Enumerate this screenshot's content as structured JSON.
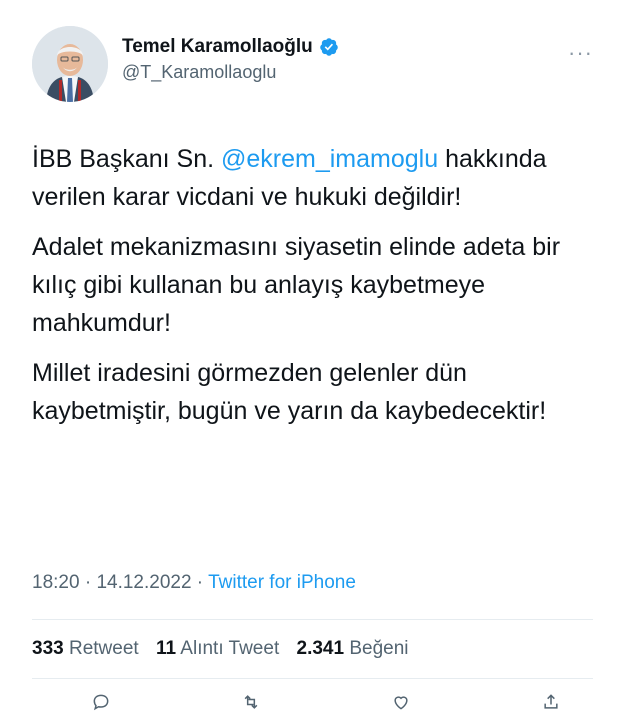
{
  "user": {
    "display_name": "Temel Karamollaoğlu",
    "handle": "@T_Karamollaoglu",
    "more_label": "···"
  },
  "tweet": {
    "p1_pre": "İBB Başkanı Sn. ",
    "p1_mention": "@ekrem_imamoglu",
    "p1_post": " hakkında verilen karar vicdani ve hukuki değildir!",
    "p2": "Adalet mekanizmasını siyasetin elinde adeta bir kılıç gibi kullanan bu anlayış kaybetmeye mahkumdur!",
    "p3": "Millet iradesini görmezden gelenler dün kaybetmiştir, bugün ve yarın da kaybedecektir!"
  },
  "meta": {
    "time": "18:20",
    "sep1": " · ",
    "date": "14.12.2022",
    "sep2": " · ",
    "source": "Twitter for iPhone"
  },
  "stats": {
    "retweets_count": "333",
    "retweets_label": "Retweet",
    "quotes_count": "11",
    "quotes_label": "Alıntı Tweet",
    "likes_count": "2.341",
    "likes_label": "Beğeni"
  },
  "colors": {
    "accent": "#1d9bf0",
    "text": "#0f1419",
    "secondary": "#536471"
  }
}
